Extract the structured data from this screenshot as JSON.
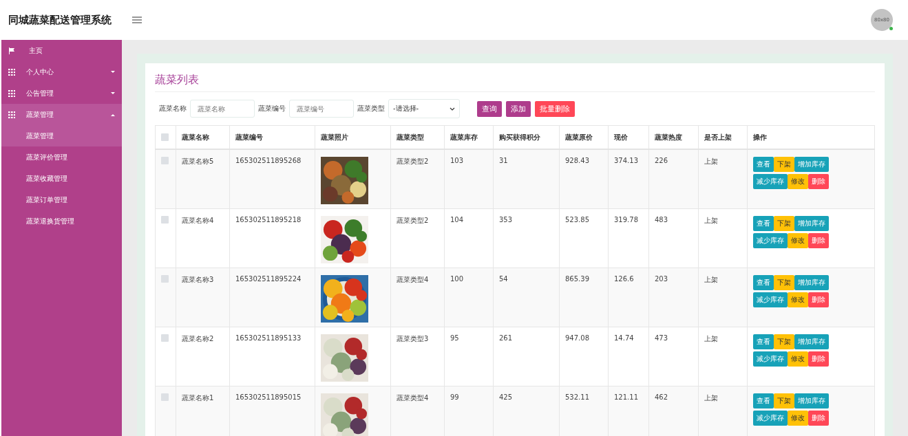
{
  "header": {
    "title": "同城蔬菜配送管理系统",
    "avatar": "80x80"
  },
  "sidebar": {
    "items": [
      {
        "label": "主页",
        "kind": "home",
        "selected": false
      },
      {
        "label": "个人中心",
        "kind": "group",
        "expanded": false
      },
      {
        "label": "公告管理",
        "kind": "group",
        "expanded": false
      },
      {
        "label": "蔬菜管理",
        "kind": "group",
        "expanded": true,
        "children": [
          {
            "label": "蔬菜管理",
            "selected": true
          },
          {
            "label": "蔬菜评价管理",
            "selected": false
          },
          {
            "label": "蔬菜收藏管理",
            "selected": false
          },
          {
            "label": "蔬菜订单管理",
            "selected": false
          },
          {
            "label": "蔬菜退换货管理",
            "selected": false
          }
        ]
      }
    ]
  },
  "panel": {
    "title": "蔬菜列表",
    "filters": [
      {
        "label": "蔬菜名称",
        "kind": "input",
        "placeholder": "蔬菜名称"
      },
      {
        "label": "蔬菜编号",
        "kind": "input",
        "placeholder": "蔬菜编号"
      },
      {
        "label": "蔬菜类型",
        "kind": "select",
        "value": "-请选择-"
      }
    ],
    "buttons": [
      {
        "label": "查询",
        "kind": "primary"
      },
      {
        "label": "添加",
        "kind": "primary"
      },
      {
        "label": "批量删除",
        "kind": "danger"
      }
    ],
    "table": {
      "select_all_checked": false,
      "columns": [
        "蔬菜名称",
        "蔬菜编号",
        "蔬菜照片",
        "蔬菜类型",
        "蔬菜库存",
        "购买获得积分",
        "蔬菜原价",
        "现价",
        "蔬菜热度",
        "是否上架",
        "操作"
      ],
      "rows": [
        {
          "checked": false,
          "name": "蔬菜名称5",
          "code": "165302511895268",
          "photo": {
            "kind": "picture"
          },
          "type": "蔬菜类型2",
          "stock": "103",
          "points": "31",
          "original_price": "928.43",
          "price": "374.13",
          "heat": "226",
          "on_shelf": "上架",
          "actions": [
            [
              {
                "label": "查看",
                "kind": "info"
              },
              {
                "label": "下架",
                "kind": "warning"
              },
              {
                "label": "增加库存",
                "kind": "info"
              }
            ],
            [
              {
                "label": "减少库存",
                "kind": "info"
              },
              {
                "label": "修改",
                "kind": "warning"
              },
              {
                "label": "删除",
                "kind": "danger"
              }
            ]
          ]
        },
        {
          "checked": false,
          "name": "蔬菜名称4",
          "code": "165302511895218",
          "photo": {
            "kind": "picture"
          },
          "type": "蔬菜类型2",
          "stock": "104",
          "points": "353",
          "original_price": "523.85",
          "price": "319.78",
          "heat": "483",
          "on_shelf": "上架",
          "actions": [
            [
              {
                "label": "查看",
                "kind": "info"
              },
              {
                "label": "下架",
                "kind": "warning"
              },
              {
                "label": "增加库存",
                "kind": "info"
              }
            ],
            [
              {
                "label": "减少库存",
                "kind": "info"
              },
              {
                "label": "修改",
                "kind": "warning"
              },
              {
                "label": "删除",
                "kind": "danger"
              }
            ]
          ]
        },
        {
          "checked": false,
          "name": "蔬菜名称3",
          "code": "165302511895224",
          "photo": {
            "kind": "picture"
          },
          "type": "蔬菜类型4",
          "stock": "100",
          "points": "54",
          "original_price": "865.39",
          "price": "126.6",
          "heat": "203",
          "on_shelf": "上架",
          "actions": [
            [
              {
                "label": "查看",
                "kind": "info"
              },
              {
                "label": "下架",
                "kind": "warning"
              },
              {
                "label": "增加库存",
                "kind": "info"
              }
            ],
            [
              {
                "label": "减少库存",
                "kind": "info"
              },
              {
                "label": "修改",
                "kind": "warning"
              },
              {
                "label": "删除",
                "kind": "danger"
              }
            ]
          ]
        },
        {
          "checked": false,
          "name": "蔬菜名称2",
          "code": "165302511895133",
          "photo": {
            "kind": "picture"
          },
          "type": "蔬菜类型3",
          "stock": "95",
          "points": "261",
          "original_price": "947.08",
          "price": "14.74",
          "heat": "473",
          "on_shelf": "上架",
          "actions": [
            [
              {
                "label": "查看",
                "kind": "info"
              },
              {
                "label": "下架",
                "kind": "warning"
              },
              {
                "label": "增加库存",
                "kind": "info"
              }
            ],
            [
              {
                "label": "减少库存",
                "kind": "info"
              },
              {
                "label": "修改",
                "kind": "warning"
              },
              {
                "label": "删除",
                "kind": "danger"
              }
            ]
          ]
        },
        {
          "checked": false,
          "name": "蔬菜名称1",
          "code": "165302511895015",
          "photo": {
            "kind": "picture"
          },
          "type": "蔬菜类型4",
          "stock": "99",
          "points": "425",
          "original_price": "532.11",
          "price": "121.11",
          "heat": "462",
          "on_shelf": "上架",
          "actions": [
            [
              {
                "label": "查看",
                "kind": "info"
              },
              {
                "label": "下架",
                "kind": "warning"
              },
              {
                "label": "增加库存",
                "kind": "info"
              }
            ],
            [
              {
                "label": "减少库存",
                "kind": "info"
              },
              {
                "label": "修改",
                "kind": "warning"
              },
              {
                "label": "删除",
                "kind": "danger"
              }
            ]
          ]
        }
      ]
    }
  }
}
